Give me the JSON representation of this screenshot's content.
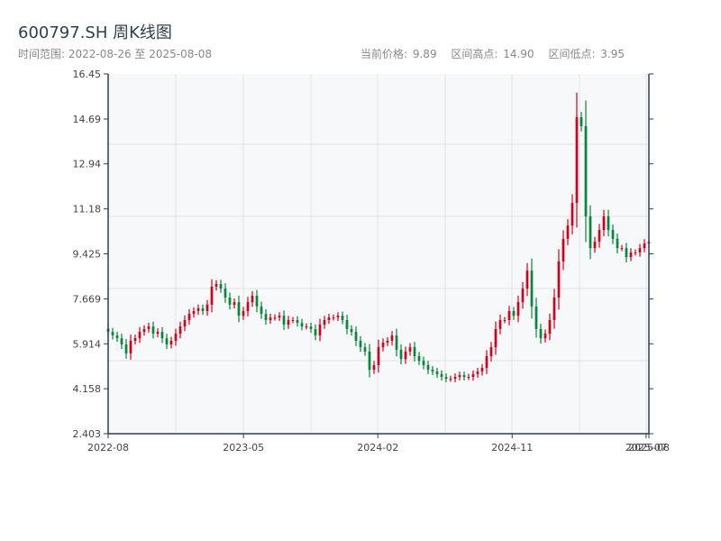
{
  "header": {
    "title": "600797.SH 周K线图",
    "range_label": "时间范围: 2022-08-26 至 2025-08-08",
    "current_price": "当前价格: 9.89",
    "range_high": "区间高点: 14.90",
    "range_low": "区间低点: 3.95"
  },
  "colors": {
    "up": "#d0021b",
    "down": "#06873a",
    "plot_bg": "#f6f8fa",
    "axis": "#2d3e50",
    "grid": "#e1e4e8"
  },
  "chart_data": {
    "type": "candlestick",
    "title": "600797.SH 周K线图",
    "xlabel": "",
    "ylabel": "",
    "ylim": [
      2.403,
      16.45
    ],
    "y_ticks": [
      "2.403",
      "4.158",
      "5.914",
      "7.669",
      "9.425",
      "11.18",
      "12.94",
      "14.69",
      "16.45"
    ],
    "x_range_weeks": [
      0,
      155
    ],
    "x_ticks": [
      {
        "label": "2022-08",
        "week": 0
      },
      {
        "label": "2023-05",
        "week": 38.8
      },
      {
        "label": "2024-02",
        "week": 77.3
      },
      {
        "label": "2024-11",
        "week": 115.8
      },
      {
        "label": "2025-07",
        "week": 154.2
      },
      {
        "label": "2025-08",
        "week": 155
      }
    ],
    "grid": true,
    "first_open": 6.5,
    "close": [
      6.38,
      6.24,
      6.13,
      5.89,
      5.54,
      6.03,
      6.13,
      6.38,
      6.49,
      6.59,
      6.31,
      6.38,
      6.13,
      5.89,
      6.03,
      6.31,
      6.59,
      6.84,
      7.08,
      7.19,
      7.3,
      7.19,
      7.44,
      8.14,
      8.25,
      8.07,
      7.72,
      7.44,
      7.54,
      7.01,
      7.19,
      7.54,
      7.79,
      7.37,
      7.08,
      6.84,
      6.94,
      6.94,
      7.01,
      6.66,
      6.84,
      6.84,
      6.73,
      6.59,
      6.59,
      6.49,
      6.24,
      6.66,
      6.84,
      6.94,
      6.94,
      7.01,
      6.84,
      6.49,
      6.38,
      6.03,
      5.78,
      5.61,
      4.9,
      5.08,
      5.78,
      5.96,
      6.03,
      6.24,
      5.68,
      5.32,
      5.61,
      5.78,
      5.43,
      5.25,
      5.08,
      4.9,
      4.83,
      4.73,
      4.62,
      4.55,
      4.55,
      4.62,
      4.69,
      4.62,
      4.62,
      4.73,
      4.83,
      4.97,
      5.43,
      5.78,
      6.49,
      6.84,
      6.84,
      7.19,
      7.01,
      7.54,
      8.07,
      8.77,
      7.37,
      6.49,
      6.13,
      6.31,
      6.84,
      7.72,
      9.13,
      10.01,
      10.53,
      11.41,
      14.76,
      14.41,
      10.89,
      9.65,
      9.9,
      10.36,
      10.89,
      10.36,
      10.01,
      9.65,
      9.65,
      9.3,
      9.48,
      9.48,
      9.65,
      9.83,
      9.89
    ]
  }
}
